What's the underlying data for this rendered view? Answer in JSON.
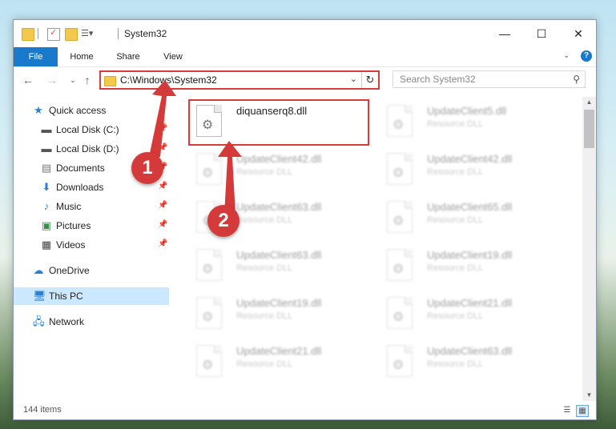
{
  "window": {
    "title": "System32"
  },
  "ribbon": {
    "tabs": [
      "File",
      "Home",
      "Share",
      "View"
    ]
  },
  "nav": {
    "address": "C:\\Windows\\System32",
    "search_placeholder": "Search System32"
  },
  "sidebar": {
    "items": [
      {
        "label": "Quick access",
        "icon": "star-icon",
        "pinned": false
      },
      {
        "label": "Local Disk (C:)",
        "icon": "drive-icon",
        "pinned": true
      },
      {
        "label": "Local Disk (D:)",
        "icon": "drive-icon",
        "pinned": true
      },
      {
        "label": "Documents",
        "icon": "documents-icon",
        "pinned": true
      },
      {
        "label": "Downloads",
        "icon": "download-icon",
        "pinned": true
      },
      {
        "label": "Music",
        "icon": "music-icon",
        "pinned": true
      },
      {
        "label": "Pictures",
        "icon": "pictures-icon",
        "pinned": true
      },
      {
        "label": "Videos",
        "icon": "videos-icon",
        "pinned": true
      },
      {
        "label": "OneDrive",
        "icon": "cloud-icon",
        "pinned": false
      },
      {
        "label": "This PC",
        "icon": "computer-icon",
        "pinned": false,
        "selected": true
      },
      {
        "label": "Network",
        "icon": "network-icon",
        "pinned": false
      }
    ]
  },
  "files": [
    {
      "name": "diquanserq8.dll",
      "type": ""
    },
    {
      "name": "UpdateClient5.dll",
      "type": "Resource DLL"
    },
    {
      "name": "UpdateClient42.dll",
      "type": "Resource DLL"
    },
    {
      "name": "UpdateClient42.dll",
      "type": "Resource DLL"
    },
    {
      "name": "UpdateClient63.dll",
      "type": "Resource DLL"
    },
    {
      "name": "UpdateClient65.dll",
      "type": "Resource DLL"
    },
    {
      "name": "UpdateClient63.dll",
      "type": "Resource DLL"
    },
    {
      "name": "UpdateClient19.dll",
      "type": "Resource DLL"
    },
    {
      "name": "UpdateClient19.dll",
      "type": "Resource DLL"
    },
    {
      "name": "UpdateClient21.dll",
      "type": "Resource DLL"
    },
    {
      "name": "UpdateClient21.dll",
      "type": "Resource DLL"
    },
    {
      "name": "UpdateClient63.dll",
      "type": "Resource DLL"
    }
  ],
  "status": {
    "item_count": "144 items"
  },
  "annotations": {
    "step1": "1",
    "step2": "2"
  },
  "colors": {
    "accent": "#1979ca",
    "highlight": "#d93b3b"
  }
}
